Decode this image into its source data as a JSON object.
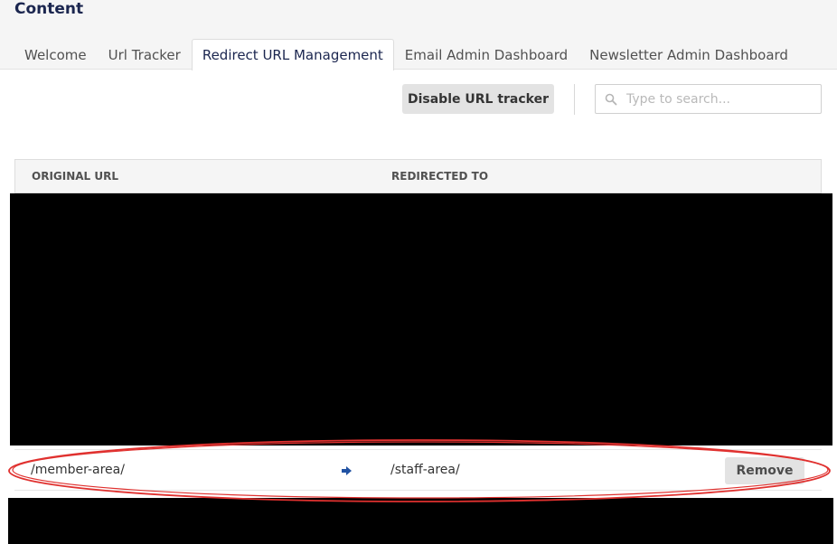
{
  "header": {
    "title": "Content"
  },
  "tabs": [
    {
      "label": "Welcome",
      "active": false
    },
    {
      "label": "Url Tracker",
      "active": false
    },
    {
      "label": "Redirect URL Management",
      "active": true
    },
    {
      "label": "Email Admin Dashboard",
      "active": false
    },
    {
      "label": "Newsletter Admin Dashboard",
      "active": false
    }
  ],
  "toolbar": {
    "disable_label": "Disable URL tracker"
  },
  "search": {
    "placeholder": "Type to search...",
    "value": "",
    "icon": "search-icon"
  },
  "table": {
    "columns": {
      "original": "ORIGINAL URL",
      "redirected": "REDIRECTED TO"
    },
    "rows": [
      {
        "original": "/member-area/",
        "arrow_icon": "arrow-right-icon",
        "redirected": "/staff-area/",
        "remove_label": "Remove"
      }
    ]
  },
  "colors": {
    "accent_blue": "#2152a3",
    "highlight_red": "#e0312f",
    "redaction": "#000000"
  }
}
